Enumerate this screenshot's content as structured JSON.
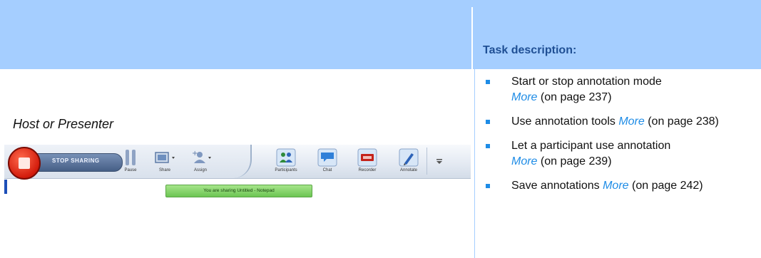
{
  "header": {
    "task_heading": "Task description:"
  },
  "role_label": "Host or Presenter",
  "toolbar": {
    "stop_label": "STOP SHARING",
    "tools": [
      {
        "label": "Pause",
        "icon": "pause-icon"
      },
      {
        "label": "Share",
        "icon": "share-icon"
      },
      {
        "label": "Assign",
        "icon": "assign-icon"
      },
      {
        "label": "Participants",
        "icon": "participants-icon"
      },
      {
        "label": "Chat",
        "icon": "chat-icon"
      },
      {
        "label": "Recorder",
        "icon": "recorder-icon"
      },
      {
        "label": "Annotate",
        "icon": "annotate-icon"
      }
    ],
    "tip": "You are sharing Untitled - Notepad"
  },
  "tasks": [
    {
      "line1": "Start or stop annotation mode",
      "more": "More",
      "ref": " (on page 237)"
    },
    {
      "line1": "Use annotation tools ",
      "more": "More",
      "ref": " (on page 238)"
    },
    {
      "line1": "Let a participant use annotation",
      "more": "More",
      "ref": " (on page 239)"
    },
    {
      "line1": "Save annotations ",
      "more": "More",
      "ref": " (on page 242)"
    }
  ],
  "colors": {
    "header": "#a5ceff",
    "accent": "#1e8ce6",
    "heading": "#1f4f94"
  }
}
